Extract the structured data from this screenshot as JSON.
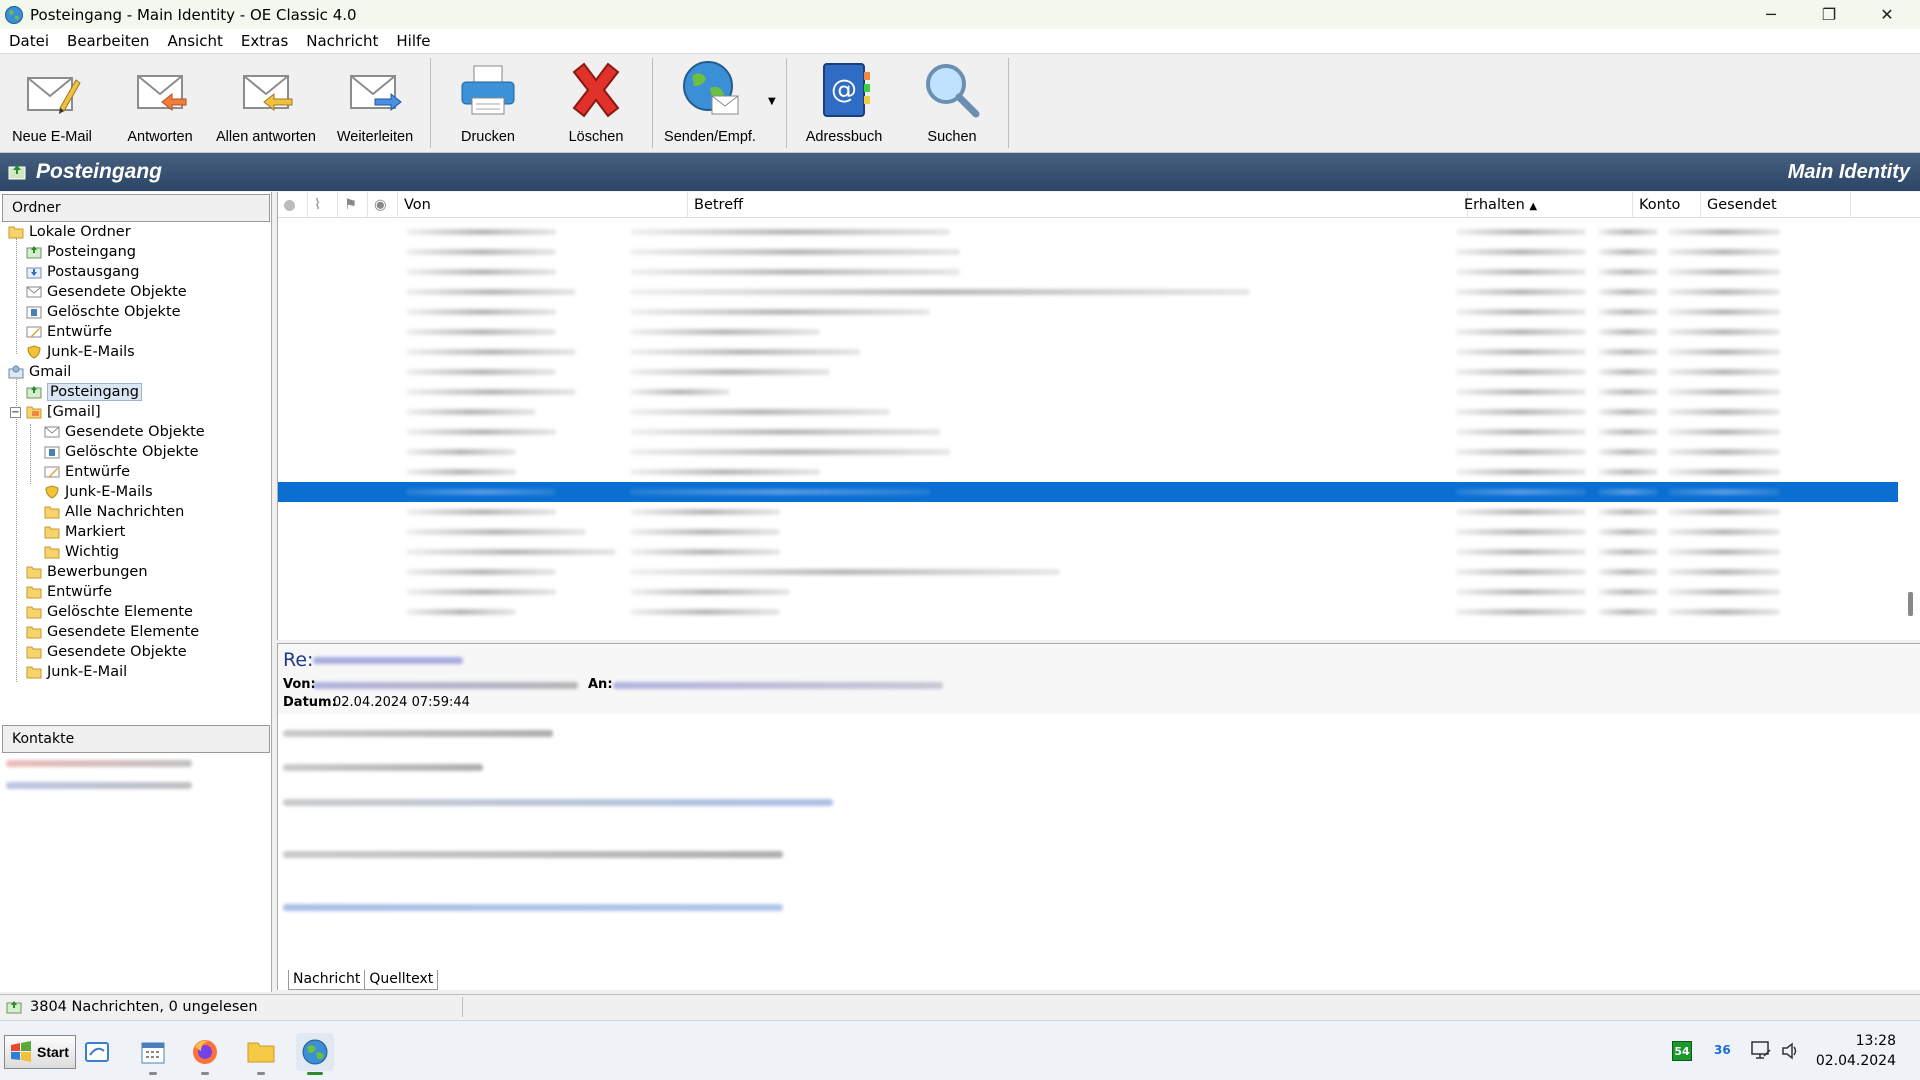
{
  "window": {
    "title": "Posteingang - Main Identity - OE Classic 4.0",
    "controls": {
      "minimize": "─",
      "maximize": "❐",
      "close": "✕"
    }
  },
  "menu": [
    "Datei",
    "Bearbeiten",
    "Ansicht",
    "Extras",
    "Nachricht",
    "Hilfe"
  ],
  "toolbar": {
    "new_mail": "Neue E-Mail",
    "reply": "Antworten",
    "reply_all": "Allen antworten",
    "forward": "Weiterleiten",
    "print": "Drucken",
    "delete": "Löschen",
    "send_receive": "Senden/Empf.",
    "address_book": "Adressbuch",
    "search": "Suchen"
  },
  "band": {
    "folder": "Posteingang",
    "identity": "Main Identity"
  },
  "folders": {
    "header": "Ordner",
    "local": "Lokale Ordner",
    "local_items": [
      "Posteingang",
      "Postausgang",
      "Gesendete Objekte",
      "Gelöschte Objekte",
      "Entwürfe",
      "Junk-E-Mails"
    ],
    "gmail": "Gmail",
    "gmail_inbox": "Posteingang",
    "gmail_group": "[Gmail]",
    "gmail_group_items": [
      "Gesendete Objekte",
      "Gelöschte Objekte",
      "Entwürfe",
      "Junk-E-Mails",
      "Alle Nachrichten",
      "Markiert",
      "Wichtig"
    ],
    "gmail_other": [
      "Bewerbungen",
      "Entwürfe",
      "Gelöschte Elemente",
      "Gesendete Elemente",
      "Gesendete Objekte",
      "Junk-E-Mail"
    ]
  },
  "contacts": {
    "header": "Kontakte"
  },
  "list": {
    "columns": {
      "from": "Von",
      "subject": "Betreff",
      "received": "Erhalten",
      "account": "Konto",
      "sent": "Gesendet"
    },
    "sort_indicator": "▲"
  },
  "preview": {
    "subject_prefix": "Re:",
    "from_label": "Von:",
    "to_label": "An:",
    "date_label": "Datum:",
    "date_value": "02.04.2024 07:59:44",
    "tabs": [
      "Nachricht",
      "Quelltext"
    ]
  },
  "status": {
    "text": "3804 Nachrichten, 0 ungelesen"
  },
  "taskbar": {
    "start": "Start",
    "tray_badge": "54",
    "tray_temp": "36",
    "time": "13:28",
    "date": "02.04.2024"
  },
  "colors": {
    "selection": "#0a6fd1",
    "band": "#2b4566",
    "link_blue": "#1f3a8a"
  }
}
